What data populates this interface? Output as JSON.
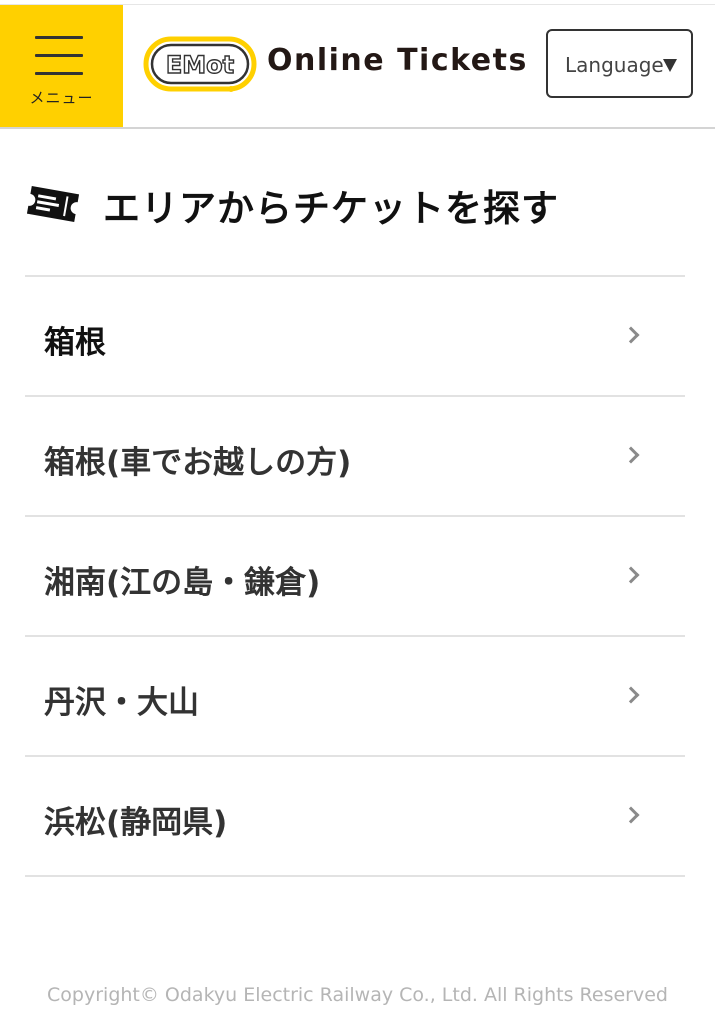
{
  "header": {
    "menu_label": "メニュー",
    "logo_text": "Online Tickets",
    "logo_mark_text": "EMot",
    "language_label": "Language"
  },
  "section": {
    "title": "エリアからチケットを探す"
  },
  "areas": [
    {
      "label": "箱根"
    },
    {
      "label": "箱根(車でお越しの方)"
    },
    {
      "label": "湘南(江の島・鎌倉)"
    },
    {
      "label": "丹沢・大山"
    },
    {
      "label": "浜松(静岡県)"
    }
  ],
  "footer": {
    "copyright": "Copyright© Odakyu Electric Railway Co., Ltd. All Rights Reserved"
  },
  "colors": {
    "brand_yellow": "#ffd000",
    "text_dark": "#222222",
    "divider": "#e2e2e2",
    "footer_text": "#b5b5b5"
  },
  "icons": [
    "hamburger-menu-icon",
    "emot-logo",
    "dropdown-arrow-icon",
    "ticket-icon",
    "chevron-right-icon"
  ]
}
